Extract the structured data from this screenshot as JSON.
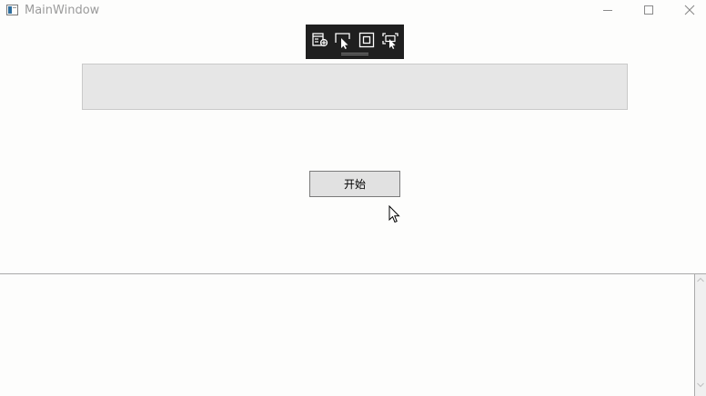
{
  "window": {
    "title": "MainWindow",
    "controls": {
      "minimize": "minimize-icon",
      "maximize": "maximize-icon",
      "close": "close-icon"
    }
  },
  "debug_toolbar": {
    "buttons": [
      {
        "icon": "live-visual-tree-icon"
      },
      {
        "icon": "select-element-icon"
      },
      {
        "icon": "display-layout-adorners-icon"
      },
      {
        "icon": "track-focused-element-icon"
      }
    ],
    "background": "#1f1f1f"
  },
  "main": {
    "text_box_value": "",
    "start_button_label": "开始"
  },
  "output": {
    "text": ""
  },
  "colors": {
    "window_bg": "#fdfdfc",
    "text_box_bg": "#e6e6e6",
    "button_bg": "#e1e1e1",
    "button_border": "#7a7a7a"
  }
}
